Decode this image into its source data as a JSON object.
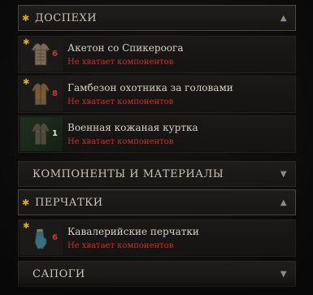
{
  "categories": [
    {
      "label": "ДОСПЕХИ",
      "starred": true,
      "arrow": "▲"
    },
    {
      "label": "КОМПОНЕНТЫ И МАТЕРИАЛЫ",
      "starred": false,
      "arrow": "▼"
    },
    {
      "label": "ПЕРЧАТКИ",
      "starred": true,
      "arrow": "▲"
    },
    {
      "label": "САПОГИ",
      "starred": false,
      "arrow": "▼"
    }
  ],
  "armor_items": [
    {
      "name": "Акетон со Спикероога",
      "qty": "6",
      "warning": "Не хватает компонентов",
      "starred": true,
      "icon": "aketon-armor-icon"
    },
    {
      "name": "Гамбезон охотника за головами",
      "qty": "8",
      "warning": "Не хватает компонентов",
      "starred": true,
      "icon": "gambeson-armor-icon"
    },
    {
      "name": "Военная кожаная куртка",
      "qty": "1",
      "warning": "Не хватает компонентов",
      "starred": false,
      "icon": "leather-jacket-icon"
    }
  ],
  "glove_items": [
    {
      "name": "Кавалерийские перчатки",
      "qty": "6",
      "warning": "Не хватает компонентов",
      "starred": true,
      "icon": "cavalry-gloves-icon"
    }
  ],
  "colors": {
    "accent_star": "#d9a91e",
    "warning_red": "#c8302a",
    "qty_red": "#c63a2f",
    "uncommon_green": "#1f3020"
  }
}
